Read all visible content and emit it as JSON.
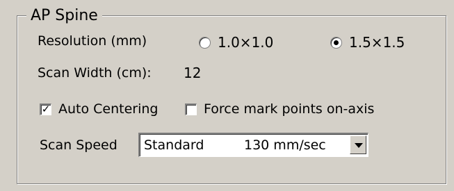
{
  "group": {
    "title": "AP Spine"
  },
  "resolution": {
    "label": "Resolution (mm)",
    "options": [
      {
        "label": "1.0×1.0",
        "selected": false
      },
      {
        "label": "1.5×1.5",
        "selected": true
      }
    ]
  },
  "scan_width": {
    "label": "Scan Width (cm):",
    "value": "12"
  },
  "auto_centering": {
    "label": "Auto Centering",
    "checked": true,
    "check_mark": "✓"
  },
  "force_mark": {
    "label": "Force mark points on-axis",
    "checked": false
  },
  "scan_speed": {
    "label": "Scan Speed",
    "selected_name": "Standard",
    "selected_speed": "130 mm/sec"
  }
}
